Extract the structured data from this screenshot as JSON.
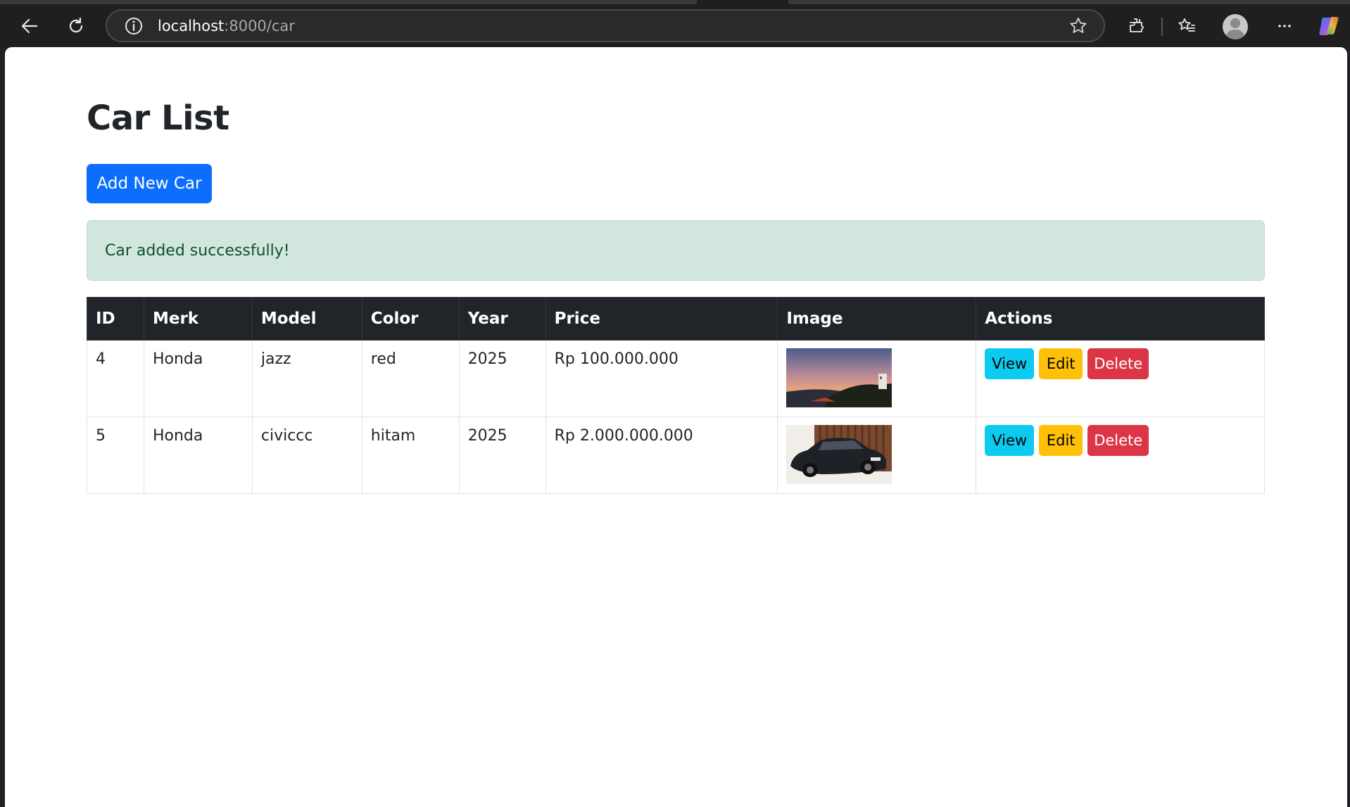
{
  "browser": {
    "url_host": "localhost",
    "url_path": ":8000/car",
    "icons": [
      "back-arrow-icon",
      "reload-icon",
      "site-info-icon",
      "favorite-star-icon",
      "extensions-icon",
      "favorites-icon",
      "profile-icon",
      "more-icon",
      "copilot-icon"
    ]
  },
  "page": {
    "title": "Car List",
    "add_button": "Add New Car",
    "alert": "Car added successfully!",
    "alert_colors": {
      "background": "#d1e7dd",
      "text": "#0f5132"
    },
    "primary_color": "#0d6efd"
  },
  "table": {
    "headers": [
      "ID",
      "Merk",
      "Model",
      "Color",
      "Year",
      "Price",
      "Image",
      "Actions"
    ],
    "rows": [
      {
        "id": "4",
        "merk": "Honda",
        "model": "jazz",
        "color": "red",
        "year": "2025",
        "price": "Rp 100.000.000",
        "image": "sunset-landscape-image"
      },
      {
        "id": "5",
        "merk": "Honda",
        "model": "civiccc",
        "color": "hitam",
        "year": "2025",
        "price": "Rp 2.000.000.000",
        "image": "black-sedan-image"
      }
    ],
    "actions": {
      "view": "View",
      "edit": "Edit",
      "delete": "Delete"
    },
    "action_colors": {
      "view": "#0dcaf0",
      "edit": "#ffc107",
      "delete": "#dc3545"
    }
  }
}
